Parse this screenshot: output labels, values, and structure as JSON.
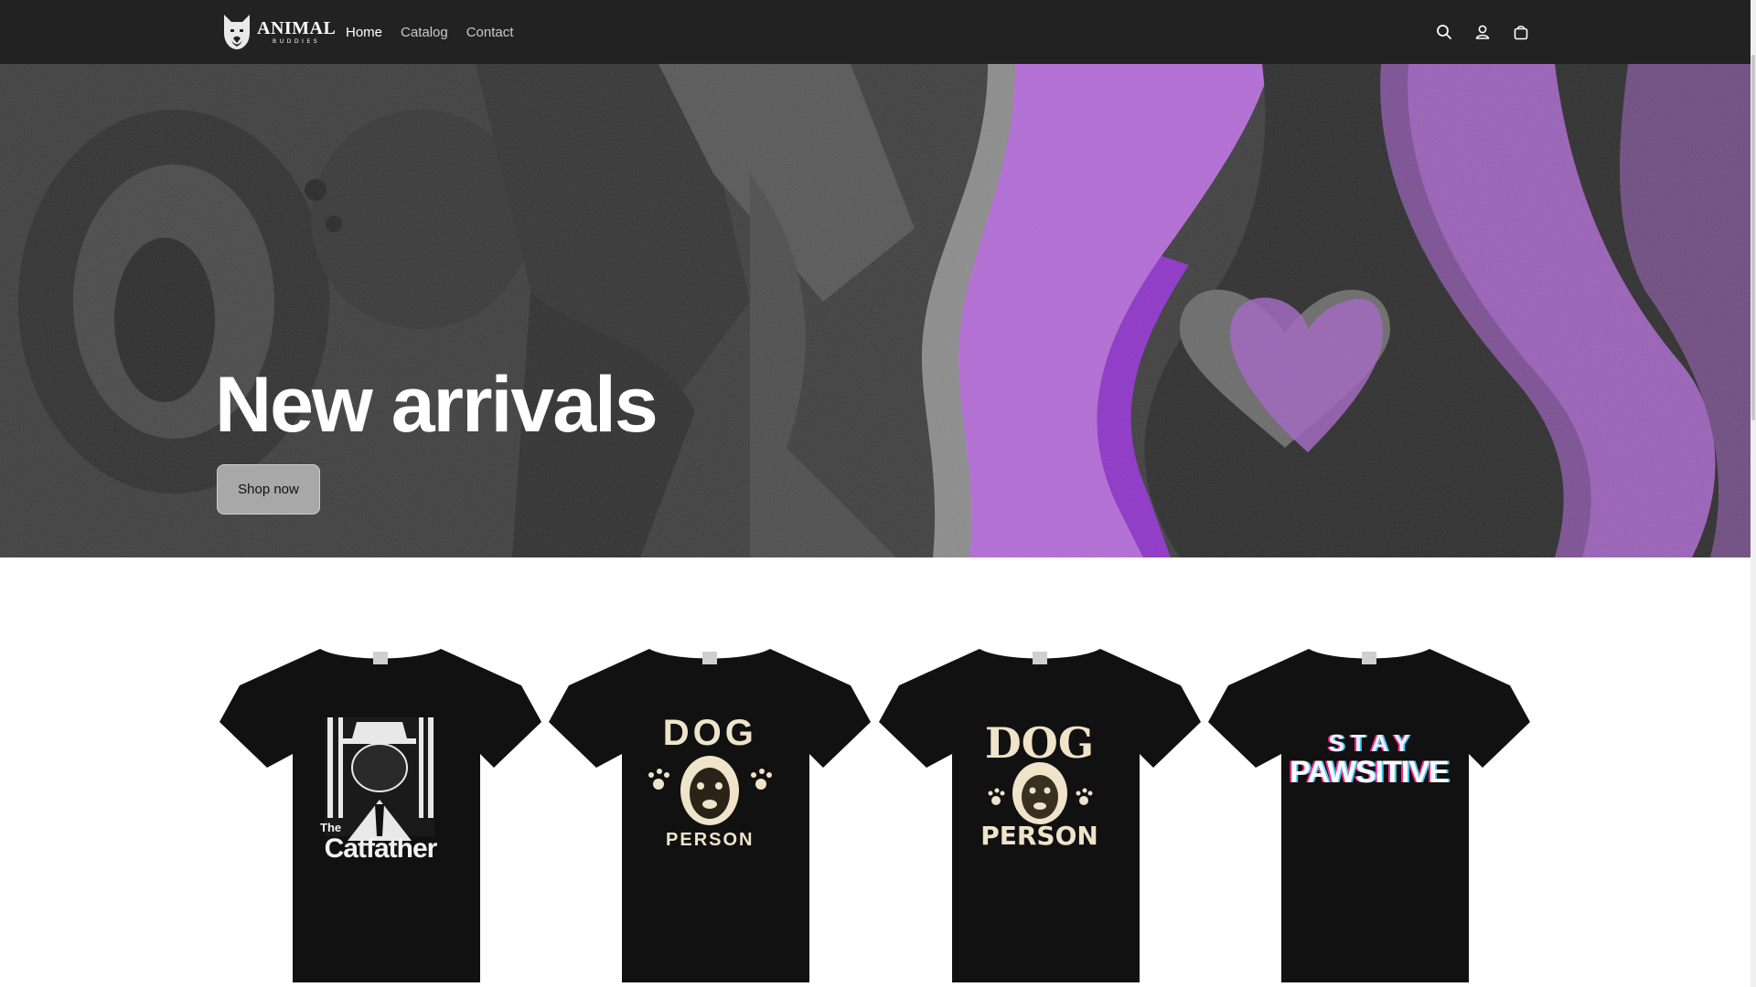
{
  "header": {
    "logo": {
      "word": "ANIMAL",
      "sub": "BUDDIES",
      "icon": "dog-head-logo-icon"
    },
    "nav": [
      {
        "label": "Home",
        "active": true
      },
      {
        "label": "Catalog",
        "active": false
      },
      {
        "label": "Contact",
        "active": false
      }
    ],
    "icons": [
      "search-icon",
      "account-icon",
      "cart-icon"
    ]
  },
  "hero": {
    "title": "New arrivals",
    "button_label": "Shop now"
  },
  "products": [
    {
      "name": "The Catfather tee",
      "print_top": "The",
      "print_main": "Catfather"
    },
    {
      "name": "Dog Person tee (round)",
      "print_top": "DOG",
      "print_main": "PERSON"
    },
    {
      "name": "Dog Person tee (block)",
      "print_top": "DOG",
      "print_main": "PERSON"
    },
    {
      "name": "Stay Pawsitive tee",
      "print_top": "S T A Y",
      "print_main": "PAWSITIVE"
    }
  ],
  "colors": {
    "header_bg": "#222222",
    "accent_purple": "#b26bd6",
    "tshirt": "#111111",
    "print_cream": "#efe3c9"
  }
}
